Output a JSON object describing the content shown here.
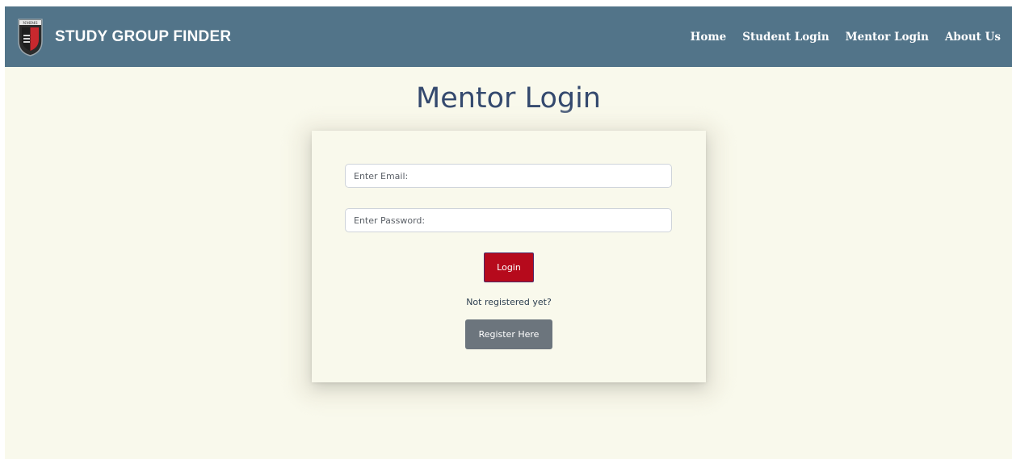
{
  "navbar": {
    "brand": "STUDY GROUP FINDER",
    "logo_text": "NMIMS",
    "logo_icon": "shield-crest-icon",
    "links": [
      {
        "label": "Home"
      },
      {
        "label": "Student Login"
      },
      {
        "label": "Mentor Login"
      },
      {
        "label": "About Us"
      }
    ]
  },
  "page": {
    "title": "Mentor Login"
  },
  "form": {
    "email_placeholder": "Enter Email:",
    "email_value": "",
    "password_placeholder": "Enter Password:",
    "password_value": "",
    "login_label": "Login",
    "not_registered_text": "Not registered yet?",
    "register_label": "Register Here"
  },
  "colors": {
    "navbar": "#527489",
    "background": "#f9f9ec",
    "title": "#34496e",
    "login_button": "#b60a1c",
    "register_button": "#6c757d"
  }
}
